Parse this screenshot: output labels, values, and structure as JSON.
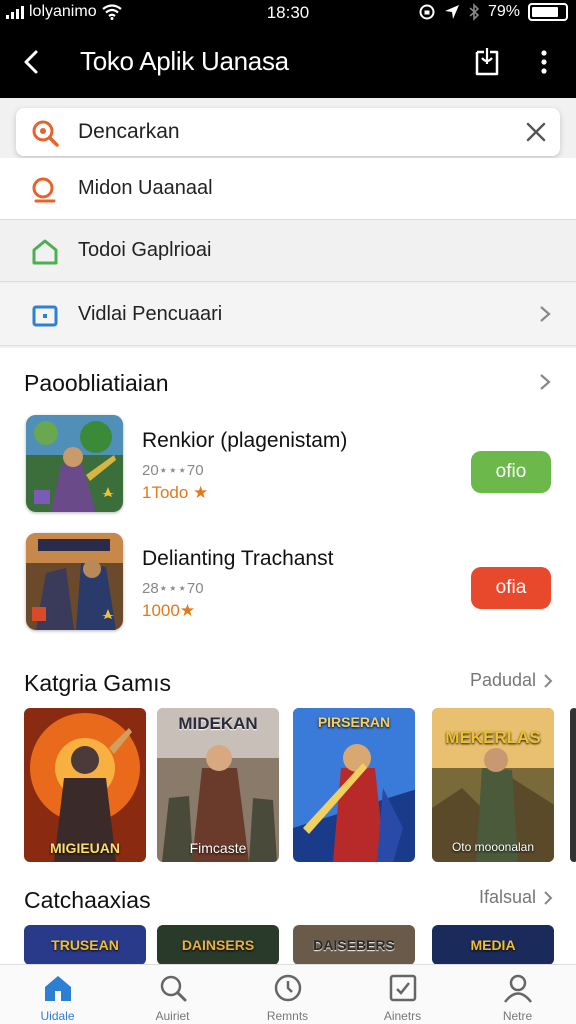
{
  "status_bar": {
    "carrier": "lolyanimo",
    "time": "18:30",
    "battery": "79%"
  },
  "app_bar": {
    "title": "Toko Aplik Uanasa"
  },
  "search": {
    "value": "Dencarkan",
    "suggestions": [
      {
        "label": "Midon Uaanaal",
        "icon": "search-icon",
        "color": "#e8622b"
      },
      {
        "label": "Todoi Gaplrioai",
        "icon": "home-icon",
        "color": "#4caf50"
      },
      {
        "label": "Vidlai Pencuaari",
        "icon": "app-icon",
        "color": "#2d7fd3"
      }
    ]
  },
  "section_popular": {
    "title": "Paoobliatiaian",
    "apps": [
      {
        "name": "Renkior (plagenistam)",
        "meta": "20⋆⋆⋆70",
        "rating": "1Todo ★",
        "button": "ofio",
        "button_color": "#6cb84a"
      },
      {
        "name": "Delianting Trachanst",
        "meta": "28⋆⋆⋆70",
        "rating": "1000★",
        "button": "ofia",
        "button_color": "#e8482b"
      }
    ]
  },
  "section_categories": {
    "title": "Katgria Gamıs",
    "link": "Padudal",
    "cards": [
      {
        "label": "MIGIEUAN",
        "top_label": ""
      },
      {
        "label": "Fimcaste",
        "top_label": "MIDEKAN"
      },
      {
        "label": "",
        "top_label": "PIRSERAN"
      },
      {
        "label": "Oto mooonalan",
        "top_label": "MEKERLAS"
      }
    ]
  },
  "section_more": {
    "title": "Catchaaxias",
    "link": "Ifalsual",
    "cards": [
      {
        "top_label": "TRUSEAN"
      },
      {
        "top_label": "DAINSERS"
      },
      {
        "top_label": "DAISEBERS"
      },
      {
        "top_label": "MEDIA"
      }
    ]
  },
  "bottom_nav": [
    {
      "label": "Uidale",
      "icon": "home-icon",
      "active": true
    },
    {
      "label": "Auiriet",
      "icon": "search-icon",
      "active": false
    },
    {
      "label": "Remnts",
      "icon": "clock-icon",
      "active": false
    },
    {
      "label": "Ainetrs",
      "icon": "checklist-icon",
      "active": false
    },
    {
      "label": "Netre",
      "icon": "person-icon",
      "active": false
    }
  ],
  "colors": {
    "accent_blue": "#2d7fd3",
    "rating_orange": "#e07a1a"
  }
}
